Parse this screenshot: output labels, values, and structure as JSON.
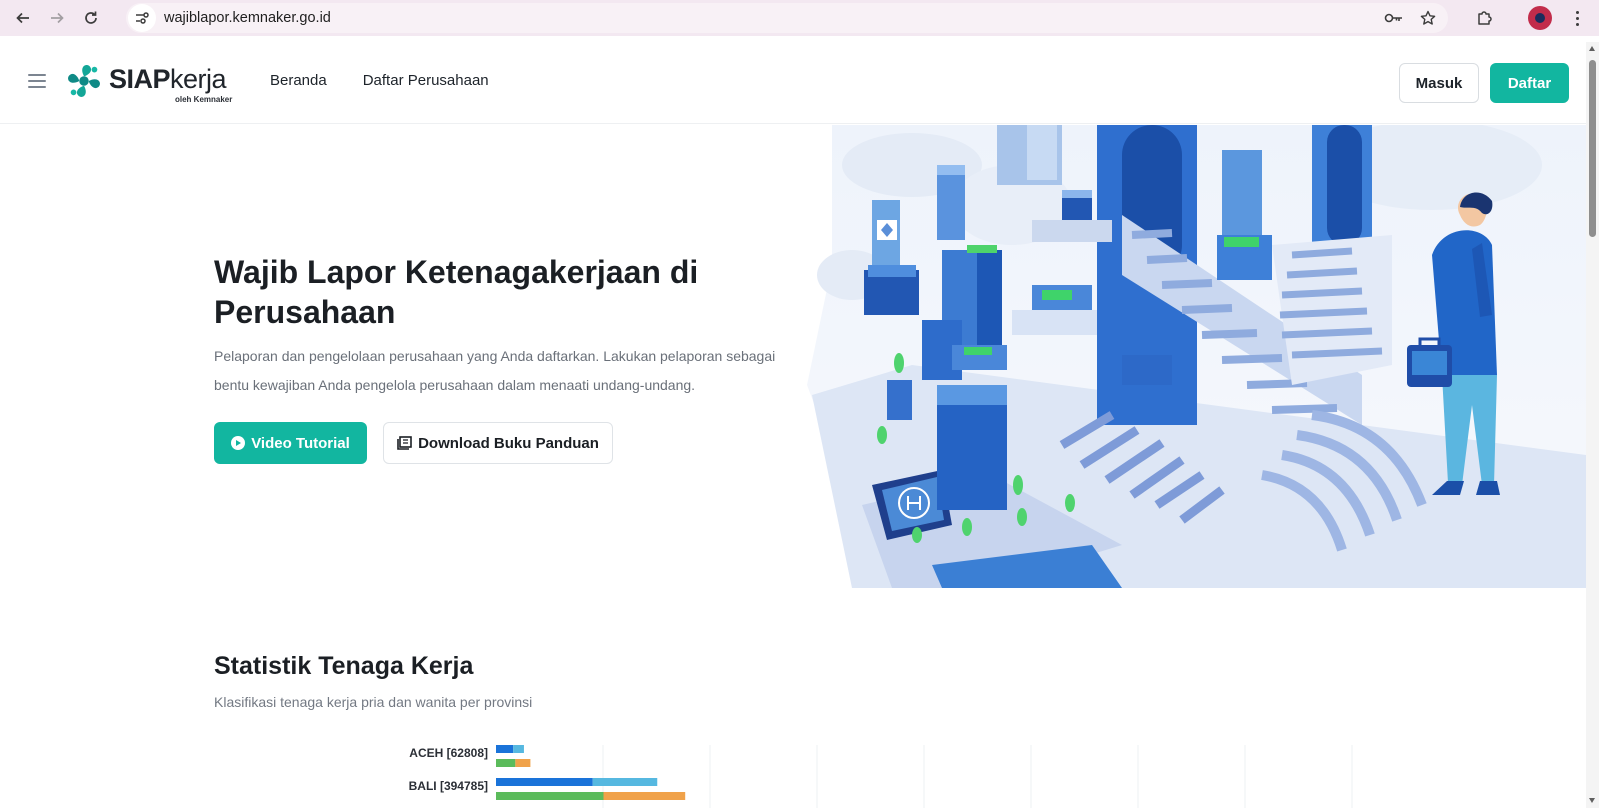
{
  "browser": {
    "url": "wajiblapor.kemnaker.go.id",
    "back_icon": "arrow-left-icon",
    "forward_icon": "arrow-right-icon",
    "reload_icon": "reload-icon",
    "site_info_icon": "tune-icon",
    "password_icon": "key-icon",
    "bookmark_icon": "star-icon",
    "extensions_icon": "puzzle-icon",
    "menu_icon": "kebab-icon"
  },
  "header": {
    "logo_main": "SIAP",
    "logo_suffix": "kerja",
    "logo_sub": "oleh Kemnaker",
    "nav": [
      "Beranda",
      "Daftar Perusahaan"
    ],
    "login_label": "Masuk",
    "register_label": "Daftar"
  },
  "hero": {
    "title": "Wajib Lapor Ketenagakerjaan di Perusahaan",
    "description": "Pelaporan dan pengelolaan perusahaan yang Anda daftarkan. Lakukan pelaporan sebagai bentu kewajiban Anda pengelola perusahaan dalam menaati undang-undang.",
    "video_button": "Video Tutorial",
    "download_button": "Download Buku Panduan"
  },
  "stats": {
    "title": "Statistik Tenaga Kerja",
    "subtitle": "Klasifikasi tenaga kerja pria dan wanita per provinsi"
  },
  "colors": {
    "brand": "#12b6a0",
    "series_blue_dark": "#1a73d9",
    "series_blue_light": "#56b8e0",
    "series_green": "#5bbb5b",
    "series_orange": "#f0a24a"
  },
  "chart_data": {
    "type": "bar",
    "orientation": "horizontal",
    "categories": [
      "ACEH [62808]",
      "BALI [394785]"
    ],
    "series": [
      {
        "values": [
          8000,
          45000
        ]
      },
      {
        "values": [
          5000,
          30000
        ]
      },
      {
        "values": [
          9000,
          50000
        ]
      },
      {
        "values": [
          7000,
          38000
        ]
      }
    ],
    "xlim": [
      0,
      400000
    ],
    "grid": true
  }
}
